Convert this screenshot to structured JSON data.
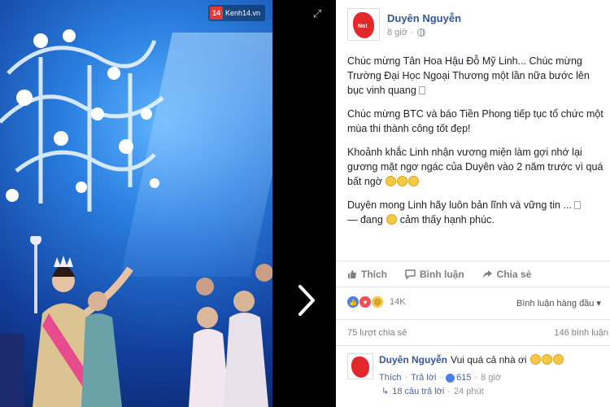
{
  "photo": {
    "watermark": "Kenh14.vn",
    "watermark_logo": "14"
  },
  "viewer": {
    "expand_icon": "expand-icon",
    "next_icon": "chevron-right-icon"
  },
  "post": {
    "author": "Duyên Nguyễn",
    "time": "8 giờ",
    "privacy_icon": "globe-icon",
    "paragraphs": {
      "p1": "Chúc mừng Tân Hoa Hậu Đỗ Mỹ Linh... Chúc mừng Trường Đại Học Ngoại Thương một lần nữa bước lên bục vinh quang",
      "p2": "Chúc mừng BTC và báo Tiền Phong tiếp tục tổ chức một mùa thi thành công tốt đẹp!",
      "p3": "Khoảnh khắc Linh nhận vương miện làm gợi nhớ lại gương mặt ngơ ngác của Duyên vào 2 năm trước vì quá bất ngờ",
      "p4a": "Duyên mong Linh hãy luôn bản lĩnh và vững tin ...",
      "p4b": "— đang",
      "p4c": "cảm thấy hạnh phúc."
    }
  },
  "actions": {
    "like": "Thích",
    "comment": "Bình luận",
    "share": "Chia sẻ"
  },
  "reactions": {
    "count": "14K",
    "sort_label": "Bình luận hàng đầu"
  },
  "counts": {
    "shares": "75 lượt chia sẻ",
    "comments": "146 bình luận"
  },
  "comment": {
    "author": "Duyên Nguyễn",
    "text": "Vui quá cả nhà ơi",
    "like_label": "Thích",
    "reply_label": "Trả lời",
    "like_count": "615",
    "time": "8 giờ",
    "replies_label": "18 câu trả lời",
    "replies_time": "24 phút"
  }
}
